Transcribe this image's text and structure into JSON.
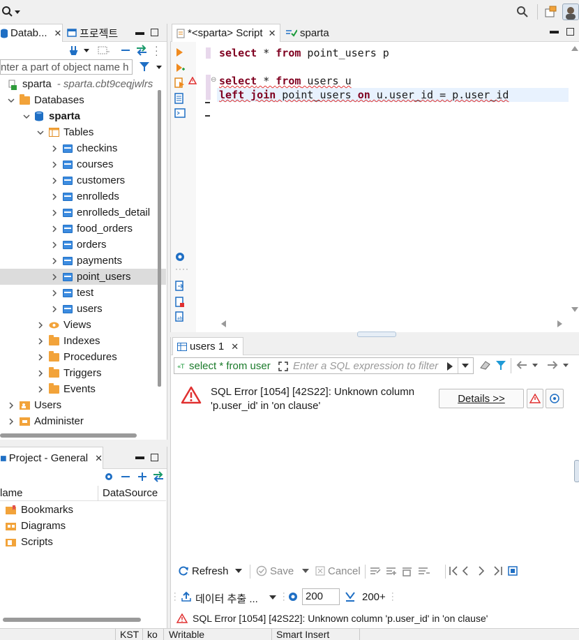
{
  "navigator": {
    "tab_db": "Datab...",
    "tab_project": "프로젝트",
    "search_placeholder": "nter a part of object name h",
    "connection": "sparta",
    "connection_host": "- sparta.cbt9ceqjwlrs",
    "databases": "Databases",
    "db": "sparta",
    "tables": "Tables",
    "table_items": [
      "checkins",
      "courses",
      "customers",
      "enrolleds",
      "enrolleds_detail",
      "food_orders",
      "orders",
      "payments",
      "point_users",
      "test",
      "users"
    ],
    "selected_table": "point_users",
    "folders": [
      "Views",
      "Indexes",
      "Procedures",
      "Triggers",
      "Events"
    ],
    "users": "Users",
    "administer": "Administer"
  },
  "project": {
    "tab": "Project - General",
    "col_name": "lame",
    "col_datasource": "DataSource",
    "items": [
      "Bookmarks",
      "Diagrams",
      "Scripts"
    ]
  },
  "editor": {
    "tab_script": "*<sparta> Script",
    "tab_sparta": "sparta",
    "line1_kw1": "select",
    "line1_mid": " * ",
    "line1_kw2": "from",
    "line1_rest": " point_users p",
    "line2_kw1": "select",
    "line2_mid": " * ",
    "line2_kw2": "from",
    "line2_rest": " users u",
    "line3_kw1": "left join",
    "line3_a": " point_users ",
    "line3_kw2": "on",
    "line3_b": " u.user_id = p.user_id"
  },
  "results": {
    "tab": "users 1",
    "filter_query": "select * from user",
    "filter_placeholder": "Enter a SQL expression to filter",
    "error_line1": "SQL Error [1054] [42S22]: Unknown column",
    "error_line2": "'p.user_id' in 'on clause'",
    "details_button": "Details >>",
    "refresh": "Refresh",
    "save": "Save",
    "cancel": "Cancel",
    "export": "데이터 추출 ...",
    "fetch_size": "200",
    "fetch_more": "200+",
    "bottom_error": "SQL Error [1054] [42S22]: Unknown column 'p.user_id' in 'on clause'"
  },
  "status": {
    "tz": "KST",
    "lang": "ko",
    "mode": "Writable",
    "insert": "Smart Insert"
  },
  "colors": {
    "keyword": "#7f0020",
    "error": "#e03030",
    "accent": "#1f6fc4",
    "folder": "#f2a33a"
  }
}
